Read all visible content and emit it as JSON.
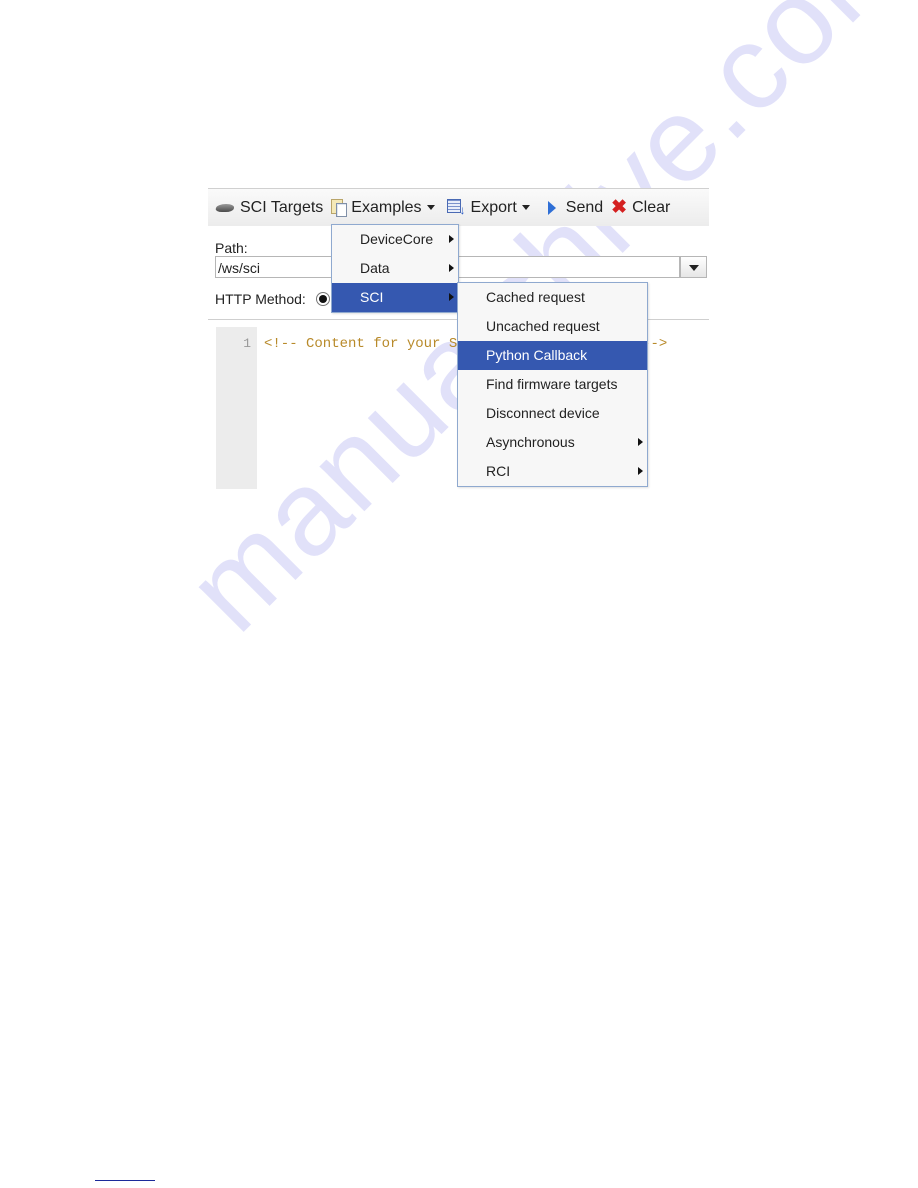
{
  "watermark": "manualshive.com",
  "toolbar": {
    "items": [
      {
        "label": "SCI Targets",
        "icon": "sci-targets-icon"
      },
      {
        "label": "Examples",
        "icon": "examples-icon",
        "dropdown": true
      },
      {
        "label": "Export",
        "icon": "export-icon",
        "dropdown": true
      },
      {
        "label": "Send",
        "icon": "send-icon"
      },
      {
        "label": "Clear",
        "icon": "clear-icon"
      }
    ]
  },
  "path": {
    "label": "Path:",
    "value": "/ws/sci"
  },
  "http_method": {
    "label": "HTTP Method:"
  },
  "editor": {
    "line_number": "1",
    "content": "<!-- Content for your SCI requests goes here -->"
  },
  "examples_menu": {
    "items": [
      {
        "label": "DeviceCore",
        "submenu": true
      },
      {
        "label": "Data",
        "submenu": true
      },
      {
        "label": "SCI",
        "submenu": true,
        "active": true
      }
    ]
  },
  "sci_submenu": {
    "items": [
      {
        "label": "Cached request"
      },
      {
        "label": "Uncached request"
      },
      {
        "label": "Python Callback",
        "active": true
      },
      {
        "label": "Find firmware targets"
      },
      {
        "label": "Disconnect device"
      },
      {
        "label": "Asynchronous",
        "submenu": true
      },
      {
        "label": "RCI",
        "submenu": true
      }
    ]
  },
  "colors": {
    "menu_highlight": "#3558b0",
    "code_comment": "#b88a2a",
    "send_icon": "#2f6fd6",
    "clear_icon": "#d42020"
  }
}
